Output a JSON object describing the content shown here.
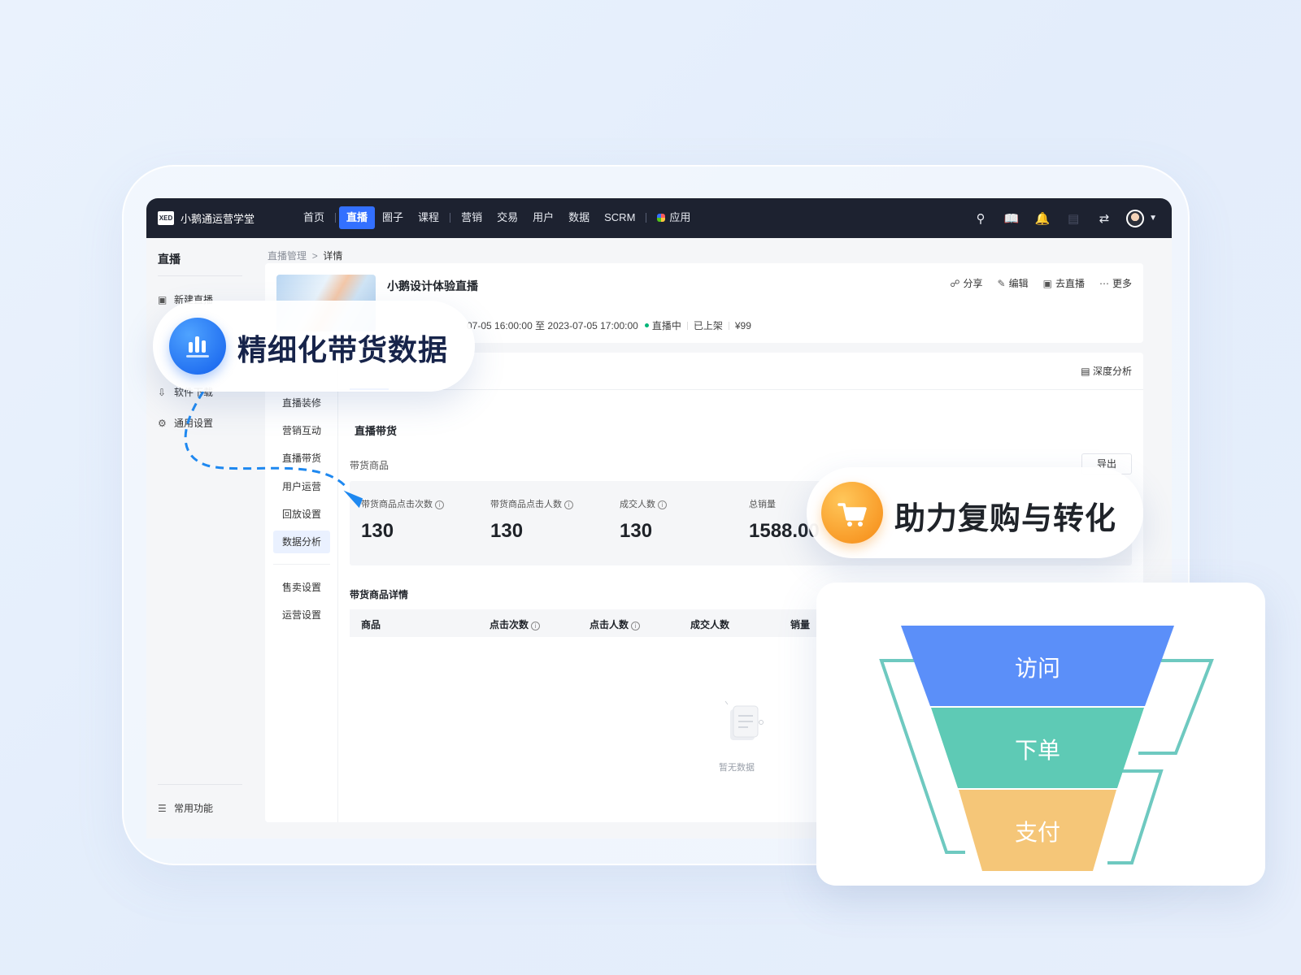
{
  "topnav": {
    "logo": "XED",
    "brand": "小鹅通运营学堂",
    "items": [
      "首页",
      "直播",
      "圈子",
      "课程",
      "营销",
      "交易",
      "用户",
      "数据",
      "SCRM",
      "应用"
    ],
    "active": "直播"
  },
  "sidebar": {
    "title": "直播",
    "items": [
      {
        "label": "新建直播",
        "icon": "video-add-icon"
      },
      {
        "label": "软件下载",
        "icon": "download-icon"
      },
      {
        "label": "通用设置",
        "icon": "gear-icon"
      }
    ],
    "footer": "常用功能"
  },
  "breadcrumb": {
    "parent": "直播管理",
    "sep": ">",
    "current": "详情"
  },
  "live": {
    "title": "小鹅设计体验直播",
    "time": "07-05 16:00:00 至 2023-07-05 17:00:00",
    "status": "直播中",
    "shelf": "已上架",
    "price": "¥99"
  },
  "actions": [
    "分享",
    "编辑",
    "去直播",
    "更多"
  ],
  "deep_analysis": "深度分析",
  "subnav": [
    "直播装修",
    "营销互动",
    "直播带货",
    "用户运营",
    "回放设置",
    "数据分析",
    "售卖设置",
    "运营设置"
  ],
  "subnav_active": "数据分析",
  "section": {
    "title": "直播带货",
    "goods_label": "带货商品",
    "export": "导出",
    "stats": [
      {
        "label": "带货商品点击次数",
        "value": "130"
      },
      {
        "label": "带货商品点击人数",
        "value": "130"
      },
      {
        "label": "成交人数",
        "value": "130"
      },
      {
        "label": "总销量",
        "value": "1588.00"
      }
    ],
    "detail_title": "带货商品详情",
    "columns": [
      "商品",
      "点击次数",
      "点击人数",
      "成交人数",
      "销量"
    ],
    "empty": "暂无数据"
  },
  "overlay": {
    "pill1": "精细化带货数据",
    "pill2": "助力复购与转化",
    "funnel": [
      "访问",
      "下单",
      "支付"
    ],
    "funnel_colors": [
      "#5b8ff9",
      "#5ecab5",
      "#f5c678"
    ]
  }
}
